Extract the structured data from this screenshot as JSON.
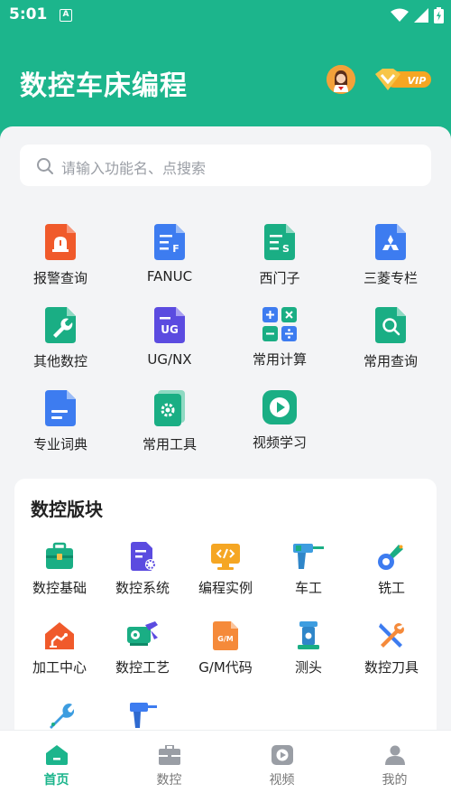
{
  "status_bar": {
    "time": "5:01",
    "notif_letter": "A"
  },
  "app": {
    "title": "数控车床编程",
    "vip_label": "VIP"
  },
  "search": {
    "placeholder": "请输入功能名、点搜索"
  },
  "functions": [
    {
      "label": "报警查询",
      "icon": "alarm-icon",
      "color": "#f05a2b"
    },
    {
      "label": "FANUC",
      "icon": "doc-f-icon",
      "color": "#3d7cf0",
      "badge": "F"
    },
    {
      "label": "西门子",
      "icon": "doc-s-icon",
      "color": "#1aae84",
      "badge": "S"
    },
    {
      "label": "三菱专栏",
      "icon": "mitsubishi-icon",
      "color": "#3d7cf0"
    },
    {
      "label": "其他数控",
      "icon": "wrench-icon",
      "color": "#1aae84"
    },
    {
      "label": "UG/NX",
      "icon": "doc-ug-icon",
      "color": "#5b4be0",
      "badge": "UG"
    },
    {
      "label": "常用计算",
      "icon": "calculator-icon",
      "color": "#3d7cf0"
    },
    {
      "label": "常用查询",
      "icon": "search-doc-icon",
      "color": "#1aae84"
    },
    {
      "label": "专业词典",
      "icon": "dictionary-icon",
      "color": "#3d7cf0"
    },
    {
      "label": "常用工具",
      "icon": "gear-doc-icon",
      "color": "#1aae84"
    },
    {
      "label": "视频学习",
      "icon": "play-icon",
      "color": "#1aae84"
    }
  ],
  "modules": {
    "title": "数控版块",
    "items": [
      {
        "label": "数控基础",
        "icon": "toolbox-icon"
      },
      {
        "label": "数控系统",
        "icon": "system-doc-icon"
      },
      {
        "label": "编程实例",
        "icon": "code-monitor-icon"
      },
      {
        "label": "车工",
        "icon": "drill-icon"
      },
      {
        "label": "铣工",
        "icon": "mill-icon"
      },
      {
        "label": "加工中心",
        "icon": "robot-house-icon"
      },
      {
        "label": "数控工艺",
        "icon": "machine-icon"
      },
      {
        "label": "G/M代码",
        "icon": "gm-file-icon",
        "badge": "G/M"
      },
      {
        "label": "测头",
        "icon": "probe-icon"
      },
      {
        "label": "数控刀具",
        "icon": "tools-icon"
      },
      {
        "label": "",
        "icon": "wrench-blue-icon"
      },
      {
        "label": "",
        "icon": "hand-drill-icon"
      }
    ]
  },
  "tabs": [
    {
      "label": "首页",
      "icon": "home-icon",
      "active": true
    },
    {
      "label": "数控",
      "icon": "briefcase-icon",
      "active": false
    },
    {
      "label": "视频",
      "icon": "video-icon",
      "active": false
    },
    {
      "label": "我的",
      "icon": "user-icon",
      "active": false
    }
  ],
  "colors": {
    "brand": "#1cb58c",
    "background": "#f3f4f6",
    "vip_gold": "#f5a623"
  }
}
